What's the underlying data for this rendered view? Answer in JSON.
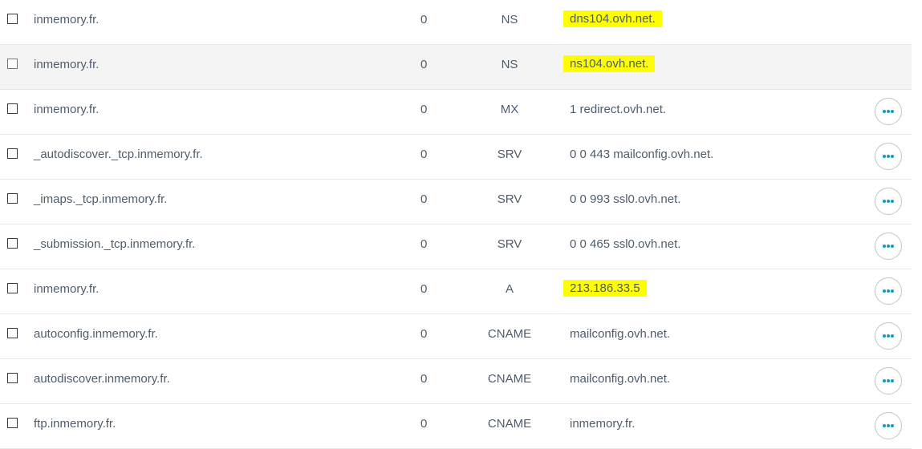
{
  "records": [
    {
      "domain": "inmemory.fr.",
      "ttl": "0",
      "type": "NS",
      "target": "dns104.ovh.net.",
      "highlighted": true,
      "has_actions": false,
      "hover": false
    },
    {
      "domain": "inmemory.fr.",
      "ttl": "0",
      "type": "NS",
      "target": "ns104.ovh.net.",
      "highlighted": true,
      "has_actions": false,
      "hover": true
    },
    {
      "domain": "inmemory.fr.",
      "ttl": "0",
      "type": "MX",
      "target": "1 redirect.ovh.net.",
      "highlighted": false,
      "has_actions": true,
      "hover": false
    },
    {
      "domain": "_autodiscover._tcp.inmemory.fr.",
      "ttl": "0",
      "type": "SRV",
      "target": "0 0 443 mailconfig.ovh.net.",
      "highlighted": false,
      "has_actions": true,
      "hover": false
    },
    {
      "domain": "_imaps._tcp.inmemory.fr.",
      "ttl": "0",
      "type": "SRV",
      "target": "0 0 993 ssl0.ovh.net.",
      "highlighted": false,
      "has_actions": true,
      "hover": false
    },
    {
      "domain": "_submission._tcp.inmemory.fr.",
      "ttl": "0",
      "type": "SRV",
      "target": "0 0 465 ssl0.ovh.net.",
      "highlighted": false,
      "has_actions": true,
      "hover": false
    },
    {
      "domain": "inmemory.fr.",
      "ttl": "0",
      "type": "A",
      "target": "213.186.33.5",
      "highlighted": true,
      "has_actions": true,
      "hover": false
    },
    {
      "domain": "autoconfig.inmemory.fr.",
      "ttl": "0",
      "type": "CNAME",
      "target": "mailconfig.ovh.net.",
      "highlighted": false,
      "has_actions": true,
      "hover": false
    },
    {
      "domain": "autodiscover.inmemory.fr.",
      "ttl": "0",
      "type": "CNAME",
      "target": "mailconfig.ovh.net.",
      "highlighted": false,
      "has_actions": true,
      "hover": false
    },
    {
      "domain": "ftp.inmemory.fr.",
      "ttl": "0",
      "type": "CNAME",
      "target": "inmemory.fr.",
      "highlighted": false,
      "has_actions": true,
      "hover": false
    }
  ],
  "colors": {
    "highlight": "#ffff00",
    "action_dots": "#0e9cc1",
    "text": "#4d5d6e",
    "row_hover": "#f4f4f4"
  },
  "icons": {
    "row_action": "more-horizontal-icon",
    "row_select": "checkbox-icon"
  }
}
